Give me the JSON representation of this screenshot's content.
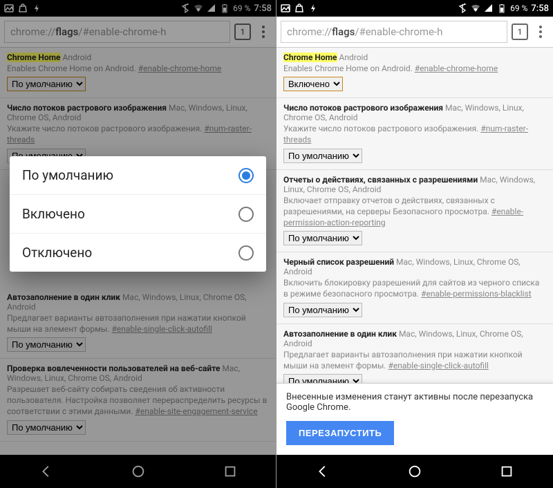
{
  "status": {
    "battery": "69 %",
    "time": "7:58"
  },
  "toolbar": {
    "url_prefix": "chrome://",
    "url_bold": "flags",
    "url_suffix": "/#enable-chrome-h",
    "tabcount": "1"
  },
  "dialog": {
    "opt_default": "По умолчанию",
    "opt_enabled": "Включено",
    "opt_disabled": "Отключено"
  },
  "flags_left": {
    "f0": {
      "title_hl": "Chrome Home",
      "title_rest": " Android",
      "desc": "Enables Chrome Home on Android. ",
      "link": "#enable-chrome-home",
      "sel": "По умолчанию"
    },
    "f1": {
      "title": "Число потоков растрового изображения",
      "plat": " Mac, Windows, Linux, Chrome OS, Android",
      "desc": "Укажите число потоков растрового изображения. ",
      "link": "#num-raster-threads",
      "sel": "По умолчанию"
    },
    "f4": {
      "title": "Автозаполнение в один клик",
      "plat": " Mac, Windows, Linux, Chrome OS, Android",
      "desc": "Предлагает варианты автозаполнения при нажатии кнопкой мыши на элемент формы. ",
      "link": "#enable-single-click-autofill",
      "sel": "По умолчанию"
    },
    "f5": {
      "title": "Проверка вовлеченности пользователей на веб-сайте",
      "plat": " Mac, Windows, Linux, Chrome OS, Android",
      "desc": "Разрешает веб-сайту собирать сведения об активности пользователя. Настройка позволяет перераспределить ресурсы в соответствии с этими данными. ",
      "link": "#enable-site-engagement-service",
      "sel": "По умолчанию"
    }
  },
  "flags_right": {
    "f0": {
      "title_hl": "Chrome Home",
      "title_rest": " Android",
      "desc": "Enables Chrome Home on Android. ",
      "link": "#enable-chrome-home",
      "sel": "Включено"
    },
    "f1": {
      "title": "Число потоков растрового изображения",
      "plat": " Mac, Windows, Linux, Chrome OS, Android",
      "desc": "Укажите число потоков растрового изображения. ",
      "link": "#num-raster-threads",
      "sel": "По умолчанию"
    },
    "f2": {
      "title": "Отчеты о действиях, связанных с разрешениями",
      "plat": " Mac, Windows, Linux, Chrome OS, Android",
      "desc": "Включает отправку отчетов о действиях, связанных с разрешениями, на серверы Безопасного просмотра. ",
      "link": "#enable-permission-action-reporting",
      "sel": "По умолчанию"
    },
    "f3": {
      "title": "Черный список разрешений",
      "plat": " Mac, Windows, Linux, Chrome OS, Android",
      "desc": "Включить блокировку разрешений для сайтов из черного списка в режиме безопасного просмотра. ",
      "link": "#enable-permissions-blacklist",
      "sel": "По умолчанию"
    },
    "f4": {
      "title": "Автозаполнение в один клик",
      "plat": " Mac, Windows, Linux, Chrome OS, Android",
      "desc": "Предлагает варианты автозаполнения при нажатии кнопкой мыши на элемент формы. ",
      "link": "#enable-single-click-autofill",
      "sel": "По умолчанию"
    }
  },
  "restart": {
    "msg": "Внесенные изменения станут активны после перезапуска Google Chrome.",
    "btn": "ПЕРЕЗАПУСТИТЬ"
  }
}
